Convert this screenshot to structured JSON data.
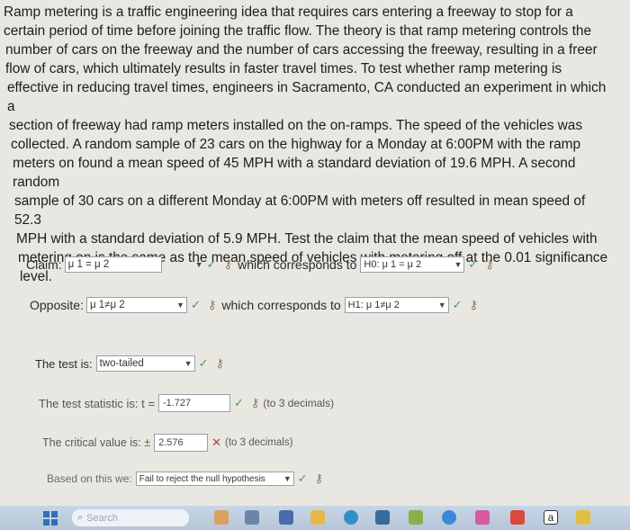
{
  "problem_text": [
    "Ramp metering is a traffic engineering idea that requires cars entering a freeway to stop for a",
    "certain period of time before joining the traffic flow. The theory is that ramp metering controls the",
    "number of cars on the freeway and the number of cars accessing the freeway, resulting in a freer",
    "flow of cars, which ultimately results in faster travel times. To test whether ramp metering is",
    "effective in reducing travel times, engineers in Sacramento, CA conducted an experiment in which a",
    "section of freeway had ramp meters installed on the on-ramps. The speed of the vehicles was",
    "collected. A random sample of 23 cars on the highway for a Monday at 6:00PM with the ramp",
    "meters on found a mean speed of 45 MPH with a standard deviation of 19.6 MPH. A second random",
    "sample of 30 cars on a different Monday at 6:00PM with meters off resulted in mean speed of 52.3",
    "MPH with a standard deviation of 5.9 MPH. Test the claim that the mean speed of vehicles with",
    "metering on is the same as the mean speed of vehicles with metering off at the 0.01 significance",
    "level."
  ],
  "claim": {
    "label": "Claim:",
    "value": "μ 1 = μ 2",
    "corresponds": "which corresponds to",
    "hyp_value": "H0: μ 1 = μ 2"
  },
  "opposite": {
    "label": "Opposite:",
    "value": "μ 1≠μ 2",
    "corresponds": "which corresponds to",
    "hyp_value": "H1: μ 1≠μ 2"
  },
  "test": {
    "label": "The test is:",
    "value": "two-tailed"
  },
  "statistic": {
    "label": "The test statistic is: t =",
    "value": "-1.727",
    "note": "(to 3 decimals)"
  },
  "critical": {
    "label": "The critical value is: ±",
    "value": "2.576",
    "note": "(to 3 decimals)"
  },
  "decision": {
    "label": "Based on this we:",
    "value": "Fail to reject the null hypothesis"
  },
  "taskbar": {
    "search_placeholder": "Search"
  },
  "colors": {
    "check": "#3aa64a",
    "cross": "#c0392b",
    "background": "#e9e7e2"
  }
}
